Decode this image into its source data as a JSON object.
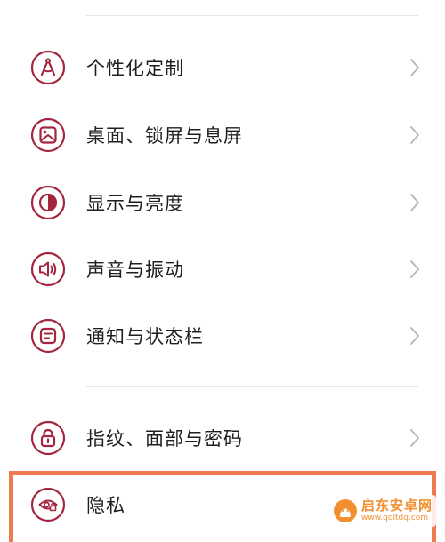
{
  "colors": {
    "icon_accent": "#a3263e",
    "chevron": "#b5b5b5",
    "divider": "#e6e6e6",
    "highlight_border": "#f07a4f",
    "watermark": "#f2902f"
  },
  "settings": {
    "items": [
      {
        "label": "个性化定制",
        "icon": "compass-icon"
      },
      {
        "label": "桌面、锁屏与息屏",
        "icon": "wallpaper-icon"
      },
      {
        "label": "显示与亮度",
        "icon": "contrast-icon"
      },
      {
        "label": "声音与振动",
        "icon": "speaker-icon"
      },
      {
        "label": "通知与状态栏",
        "icon": "notification-icon"
      },
      {
        "label": "指纹、面部与密码",
        "icon": "lock-icon"
      },
      {
        "label": "隐私",
        "icon": "privacy-icon"
      }
    ]
  },
  "watermark": {
    "title": "启东安卓网",
    "url": "www.qdltdq.com"
  }
}
